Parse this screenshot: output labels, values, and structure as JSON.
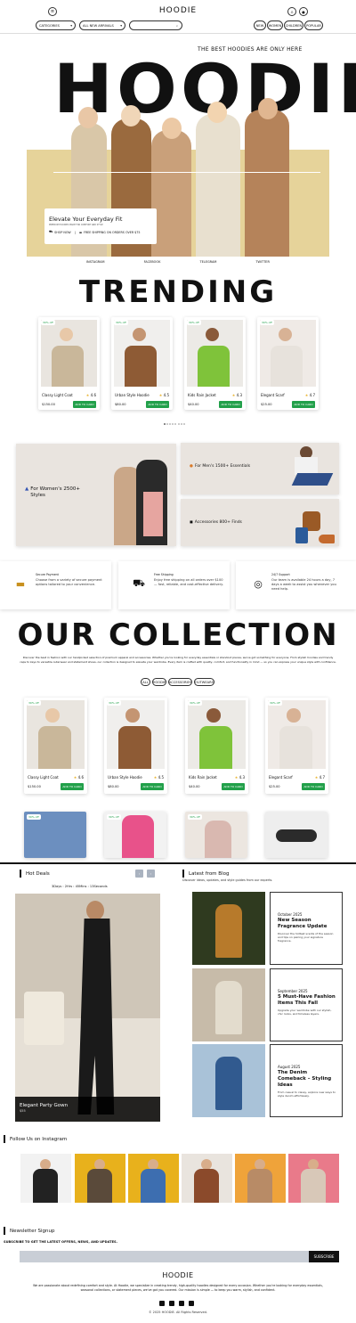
{
  "nav": {
    "brand": "HOODIE",
    "categories_select": "CATEGORIES",
    "arrivals_select": "ALL NEW ARRIVALS",
    "filters": [
      "NEW",
      "WOMEN",
      "CHILDREN",
      "POPULAR"
    ]
  },
  "hero": {
    "tagline": "THE BEST HOODIES ARE ONLY HERE",
    "title": "HOODIE",
    "promo_title": "Elevate Your Everyday Fit",
    "promo_sub": "PREMIUM HOODIES MADE FOR COMFORT AND STYLE",
    "shop_now": "SHOP NOW",
    "shipping": "FREE SHIPPING ON ORDERS OVER $75",
    "socials": [
      "INSTAGRAM",
      "FACEBOOK",
      "TELEGRAM",
      "TWITTER"
    ]
  },
  "trending": {
    "title": "TRENDING",
    "products": [
      {
        "name": "Classy Light Coat",
        "rating": "4.6",
        "price": "$150.00",
        "badge": "30% off",
        "cta": "ADD TO CARD"
      },
      {
        "name": "Urban Style Hoodie",
        "rating": "4.5",
        "price": "$80.00",
        "badge": "30% off",
        "cta": "ADD TO CARD"
      },
      {
        "name": "Kids Rain Jacket",
        "rating": "4.3",
        "price": "$40.00",
        "badge": "30% off",
        "cta": "ADD TO CARD"
      },
      {
        "name": "Elegant Scarf",
        "rating": "4.7",
        "price": "$25.00",
        "badge": "30% off",
        "cta": "ADD TO CARD"
      }
    ]
  },
  "categories": {
    "women": "For Women's 2500+ Styles",
    "men": "For Men's 1500+ Essentials",
    "accessories": "Accessories 800+ Finds"
  },
  "features": [
    {
      "title": "Secure Payment",
      "text": "Choose from a variety of secure payment options tailored to your convenience."
    },
    {
      "title": "Free Shipping",
      "text": "Enjoy free shipping on all orders over $100 — fast, reliable, and cost-effective delivery."
    },
    {
      "title": "24/7 Support",
      "text": "Our team is available 24 hours a day, 7 days a week to assist you whenever you need help."
    }
  ],
  "collection": {
    "title": "OUR COLLECTION",
    "text": "Discover the best in fashion with our handpicked selection of premium apparel and accessories. Whether you're looking for everyday essentials or standout pieces, we've got something for everyone. From stylish hoodies and trendy caps to keys to versatile outerwear and statement shoes, our collection is designed to elevate your wardrobe. Every item is crafted with quality, comfort, and functionality in mind — so you can express your unique style with confidence.",
    "filters": [
      "ALL",
      "HOODIE",
      "ACCESSORIES",
      "OUTWEARS"
    ],
    "products": [
      {
        "name": "Classy Light Coat",
        "rating": "4.6",
        "price": "$150.00",
        "badge": "30% off",
        "cta": "ADD TO CARD"
      },
      {
        "name": "Urban Style Hoodie",
        "rating": "4.5",
        "price": "$80.00",
        "badge": "30% off",
        "cta": "ADD TO CARD"
      },
      {
        "name": "Kids Rain Jacket",
        "rating": "4.3",
        "price": "$40.00",
        "badge": "30% off",
        "cta": "ADD TO CARD"
      },
      {
        "name": "Elegant Scarf",
        "rating": "4.7",
        "price": "$25.00",
        "badge": "30% off",
        "cta": "ADD TO CARD"
      }
    ],
    "badge2": "30% off"
  },
  "hot": {
    "title": "Hot Deals",
    "countdown": "3Days : 2Hrs : 45Mins : 13Seconds",
    "product": "Elegant Party Gown",
    "price": "$55"
  },
  "blog": {
    "title": "Latest from Blog",
    "sub": "Discover ideas, updates, and style guides from our experts.",
    "posts": [
      {
        "date": "October 2025",
        "title": "New Season Fragrance Update",
        "text": "Discover the hottest scents of the season and tips on pairing your signature fragrance."
      },
      {
        "date": "September 2025",
        "title": "5 Must-Have Fashion Items This Fall",
        "text": "Upgrade your wardrobe with our stylish, chic looks, and timeless layers."
      },
      {
        "date": "August 2025",
        "title": "The Denim Comeback – Styling Ideas",
        "text": "From casual to classy, explore new ways to style denim effortlessly."
      }
    ]
  },
  "instagram": {
    "title": "Follow Us on Instagram"
  },
  "newsletter": {
    "title": "Newsletter Signup",
    "sub": "SUBSCRIBE TO GET THE LATEST OFFERS, NEWS, AND UPDATES.",
    "placeholder": "",
    "button": "SUBSCRIBE"
  },
  "footer": {
    "brand": "HOODIE",
    "text": "We are passionate about redefining comfort and style. At Hoodie, we specialize in creating trendy, high-quality hoodies designed for every occasion. Whether you're looking for everyday essentials, seasonal collections, or statement pieces, we've got you covered. Our mission is simple — to keep you warm, stylish, and confident.",
    "copyright": "© 2025 HOODIE. All Rights Reserved."
  },
  "colors": {
    "accent_green": "#22a04a",
    "hero_band": "#e6d39a",
    "category_bg": "#e9e4df"
  }
}
